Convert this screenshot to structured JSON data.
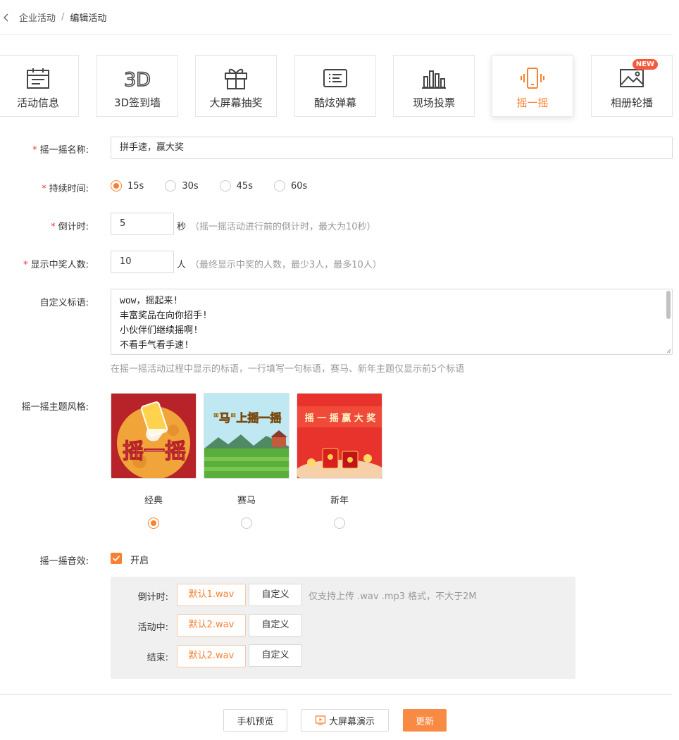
{
  "breadcrumb": {
    "parent": "企业活动",
    "separator": "/",
    "current": "编辑活动"
  },
  "tabs": [
    {
      "label": "活动信息",
      "icon": "calendar-icon"
    },
    {
      "label": "3D签到墙",
      "icon": "3d-icon"
    },
    {
      "label": "大屏幕抽奖",
      "icon": "gift-icon"
    },
    {
      "label": "酷炫弹幕",
      "icon": "danmaku-icon"
    },
    {
      "label": "现场投票",
      "icon": "bar-chart-icon"
    },
    {
      "label": "摇一摇",
      "icon": "phone-shake-icon",
      "active": true
    },
    {
      "label": "相册轮播",
      "icon": "picture-icon",
      "badge": "NEW"
    }
  ],
  "form": {
    "name": {
      "label": "摇一摇名称:",
      "required": "*",
      "value": "拼手速，赢大奖"
    },
    "duration": {
      "label": "持续时间:",
      "required": "*",
      "options": [
        "15s",
        "30s",
        "45s",
        "60s"
      ],
      "selected": "15s"
    },
    "countdown": {
      "label": "倒计时:",
      "required": "*",
      "value": "5",
      "unit": "秒",
      "hint": "（摇一摇活动进行前的倒计时，最大为10秒）"
    },
    "winners": {
      "label": "显示中奖人数:",
      "required": "*",
      "value": "10",
      "unit": "人",
      "hint": "（最终显示中奖的人数，最少3人，最多10人）"
    },
    "slogan": {
      "label": "自定义标语:",
      "lines": [
        "wow，摇起来!",
        "丰富奖品在向你招手!",
        "小伙伴们继续摇啊!",
        "不看手气看手速!"
      ],
      "hint": "在摇一摇活动过程中显示的标语，一行填写一句标语，赛马、新年主题仅显示前5个标语"
    },
    "theme": {
      "label": "摇一摇主题风格:",
      "options": [
        {
          "name": "经典",
          "art_text": "摇一摇"
        },
        {
          "name": "赛马",
          "art_text": "\"马\"上摇一摇"
        },
        {
          "name": "新年",
          "art_text": "摇 一 摇 赢 大 奖"
        }
      ],
      "selected": "经典"
    },
    "sound": {
      "label": "摇一摇音效:",
      "toggle_label": "开启",
      "enabled": true,
      "rows": [
        {
          "label": "倒计时:",
          "default": "默认1.wav",
          "custom": "自定义"
        },
        {
          "label": "活动中:",
          "default": "默认2.wav",
          "custom": "自定义"
        },
        {
          "label": "结束:",
          "default": "默认2.wav",
          "custom": "自定义"
        }
      ],
      "hint": "仅支持上传 .wav .mp3 格式，不大于2M"
    }
  },
  "footer": {
    "preview": "手机预览",
    "bigscreen": "大屏幕演示",
    "update": "更新"
  },
  "colors": {
    "accent": "#f98030",
    "required": "#e4393c",
    "primary_button": "#f98a44"
  }
}
